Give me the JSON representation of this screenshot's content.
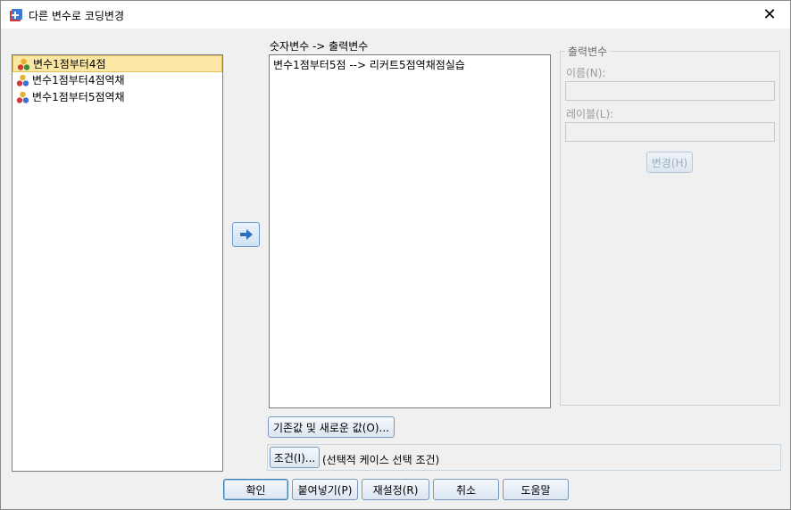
{
  "window": {
    "title": "다른 변수로 코딩변경",
    "close_glyph": "✕"
  },
  "source_variables": [
    {
      "label": "변수1점부터4점",
      "selected": true
    },
    {
      "label": "변수1점부터4점역채",
      "selected": false
    },
    {
      "label": "변수1점부터5점역채",
      "selected": false
    }
  ],
  "mapping": {
    "header": "숫자변수 -> 출력변수",
    "items": [
      "변수1점부터5점 --> 리커트5점역채점실습"
    ]
  },
  "output_variable": {
    "group_title": "출력변수",
    "name_label": "이름(N):",
    "name_value": "",
    "label_label": "레이블(L):",
    "label_value": "",
    "change_button": "변경(H)"
  },
  "buttons": {
    "old_new_values": "기존값 및 새로운 값(O)...",
    "condition": "조건(I)...",
    "condition_note": "(선택적 케이스 선택 조건)",
    "ok": "확인",
    "paste": "붙여넣기(P)",
    "reset": "재설정(R)",
    "cancel": "취소",
    "help": "도움말"
  },
  "icons": {
    "app": "spss-dialog-icon",
    "variable": "nominal-variable-icon",
    "move": "right-arrow-icon"
  }
}
